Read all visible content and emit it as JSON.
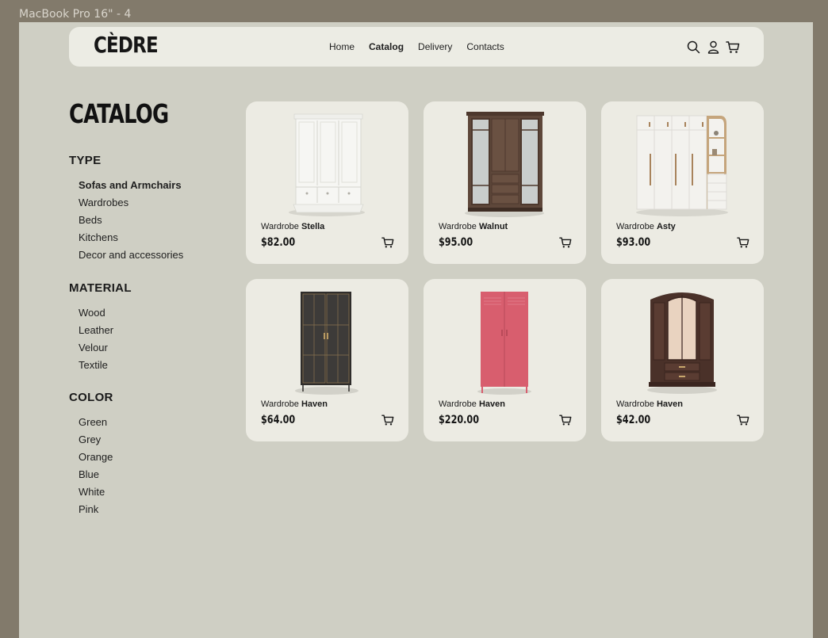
{
  "frame_label": "MacBook Pro 16\" - 4",
  "header": {
    "logo": "CÈDRE",
    "nav": [
      {
        "label": "Home",
        "active": false
      },
      {
        "label": "Catalog",
        "active": true
      },
      {
        "label": "Delivery",
        "active": false
      },
      {
        "label": "Contacts",
        "active": false
      }
    ],
    "icons": [
      "search-icon",
      "user-icon",
      "cart-icon"
    ]
  },
  "sidebar": {
    "title": "CATALOG",
    "groups": [
      {
        "heading": "TYPE",
        "items": [
          "Sofas and Armchairs",
          "Wardrobes",
          "Beds",
          "Kitchens",
          "Decor and accessories"
        ],
        "active_index": 0
      },
      {
        "heading": "MATERIAL",
        "items": [
          "Wood",
          "Leather",
          "Velour",
          "Textile"
        ]
      },
      {
        "heading": "COLOR",
        "items": [
          "Green",
          "Grey",
          "Orange",
          "Blue",
          "White",
          "Pink"
        ]
      }
    ]
  },
  "products": [
    {
      "prefix": "Wardrobe",
      "name": "Stella",
      "price": "$82.00",
      "image": "white-wardrobe",
      "color": "#f4f4f1"
    },
    {
      "prefix": "Wardrobe",
      "name": "Walnut",
      "price": "$95.00",
      "image": "walnut-wardrobe",
      "color": "#5b4538"
    },
    {
      "prefix": "Wardrobe",
      "name": "Asty",
      "price": "$93.00",
      "image": "white-shelf-wardrobe",
      "color": "#f1f0ec"
    },
    {
      "prefix": "Wardrobe",
      "name": "Haven",
      "price": "$64.00",
      "image": "dark-glass-cabinet",
      "color": "#2f2d2b"
    },
    {
      "prefix": "Wardrobe",
      "name": "Haven",
      "price": "$220.00",
      "image": "pink-locker",
      "color": "#d85e6e"
    },
    {
      "prefix": "Wardrobe",
      "name": "Haven",
      "price": "$42.00",
      "image": "brown-mirror-wardrobe",
      "color": "#4a3129"
    }
  ],
  "colors": {
    "outer": "#827a6b",
    "artboard": "#cfcfc4",
    "card": "#ecebe3"
  }
}
